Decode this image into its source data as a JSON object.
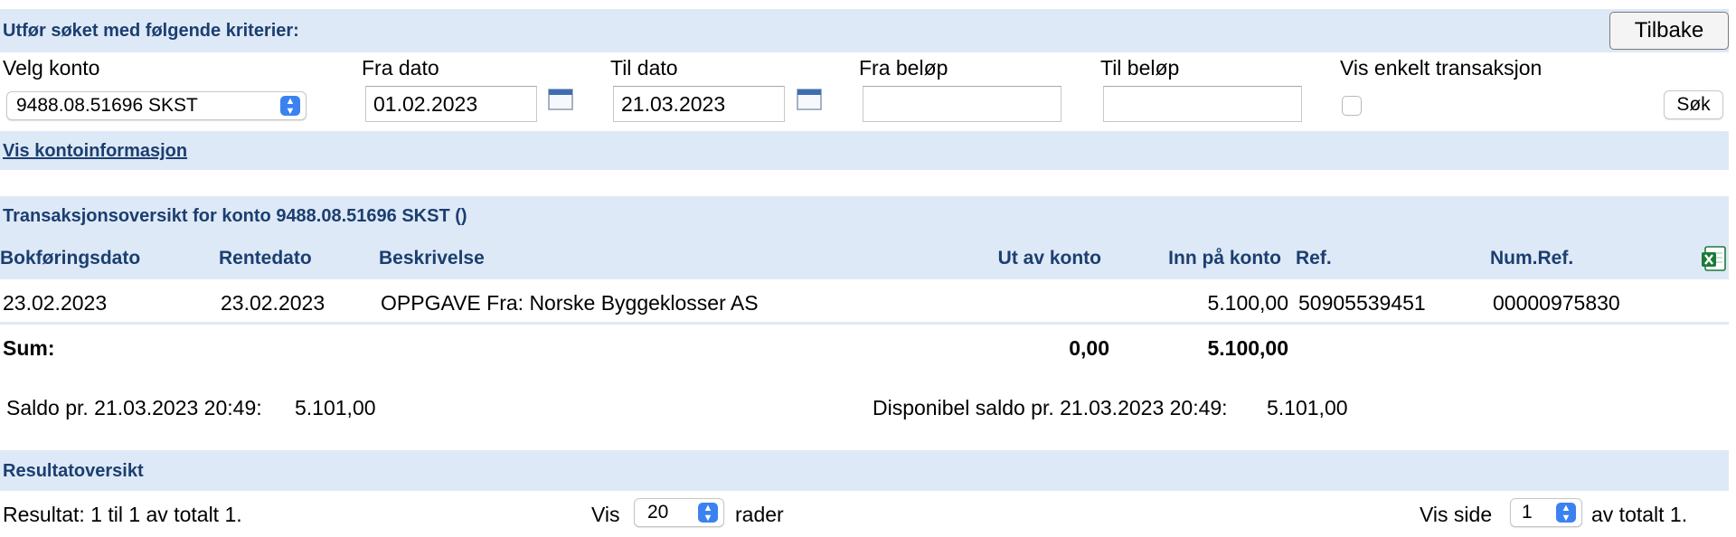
{
  "search": {
    "heading": "Utfør søket med følgende kriterier:",
    "back_button": "Tilbake",
    "account_label": "Velg konto",
    "account_value": "9488.08.51696 SKST",
    "from_date_label": "Fra dato",
    "from_date_value": "01.02.2023",
    "to_date_label": "Til dato",
    "to_date_value": "21.03.2023",
    "from_amount_label": "Fra beløp",
    "from_amount_value": "",
    "to_amount_label": "Til beløp",
    "to_amount_value": "",
    "single_tx_label": "Vis enkelt transaksjon",
    "single_tx_checked": false,
    "search_button": "Søk"
  },
  "account_info_link": "Vis kontoinformasjon",
  "transactions": {
    "heading": "Transaksjonsoversikt for konto 9488.08.51696 SKST ()",
    "columns": {
      "booking_date": "Bokføringsdato",
      "interest_date": "Rentedato",
      "description": "Beskrivelse",
      "out": "Ut av konto",
      "in": "Inn på konto",
      "ref": "Ref.",
      "num_ref": "Num.Ref."
    },
    "rows": [
      {
        "booking_date": "23.02.2023",
        "interest_date": "23.02.2023",
        "description": "OPPGAVE Fra: Norske Byggeklosser AS",
        "out": "",
        "in": "5.100,00",
        "ref": "50905539451",
        "num_ref": "00000975830"
      }
    ],
    "sum_label": "Sum:",
    "sum_out": "0,00",
    "sum_in": "5.100,00"
  },
  "balance": {
    "saldo_label": "Saldo pr. 21.03.2023 20:49:",
    "saldo_value": "5.101,00",
    "available_label": "Disponibel saldo pr. 21.03.2023 20:49:",
    "available_value": "5.101,00"
  },
  "results": {
    "heading": "Resultatoversikt",
    "summary": "Resultat: 1 til 1 av totalt 1.",
    "show_label": "Vis",
    "rows_value": "20",
    "rows_label": "rader",
    "page_label": "Vis side",
    "page_value": "1",
    "page_total": "av totalt 1."
  },
  "icons": {
    "calendar": "calendar-icon",
    "excel": "excel-export-icon",
    "select_arrows": "chevron-up-down-icon"
  },
  "colors": {
    "band_background": "#dde9f6",
    "heading_text": "#1c3e70",
    "select_accent": "#3b82f0",
    "excel_green": "#1d7a3a"
  }
}
